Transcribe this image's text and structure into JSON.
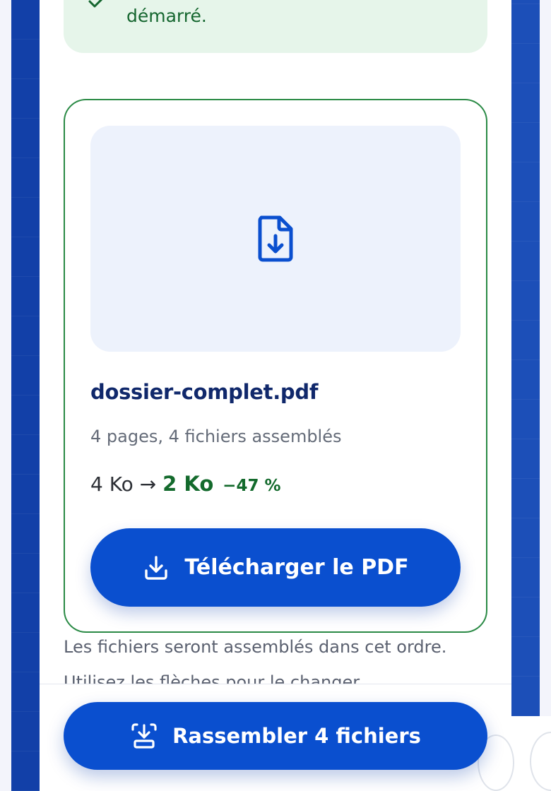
{
  "notice": {
    "text": "démarré.",
    "icon": "check-icon"
  },
  "result": {
    "preview_icon": "file-download-icon",
    "filename": "dossier-complet.pdf",
    "meta": "4 pages, 4 fichiers assemblés",
    "size_before": "4 Ko",
    "arrow": "→",
    "size_after": "2 Ko",
    "reduction": "−47 %",
    "download_label": "Télécharger le PDF",
    "download_icon": "download-icon"
  },
  "hint": {
    "line1": "Les fichiers seront assemblés dans cet ordre.",
    "line2": "Utilisez les flèches pour le changer."
  },
  "action": {
    "gather_label": "Rassembler 4 fichiers",
    "gather_icon": "merge-icon"
  },
  "colors": {
    "primary": "#0a4fcf",
    "success": "#136a2c",
    "success_bg": "#e6f5ea",
    "card_border": "#2a8a45",
    "title": "#10286b"
  }
}
